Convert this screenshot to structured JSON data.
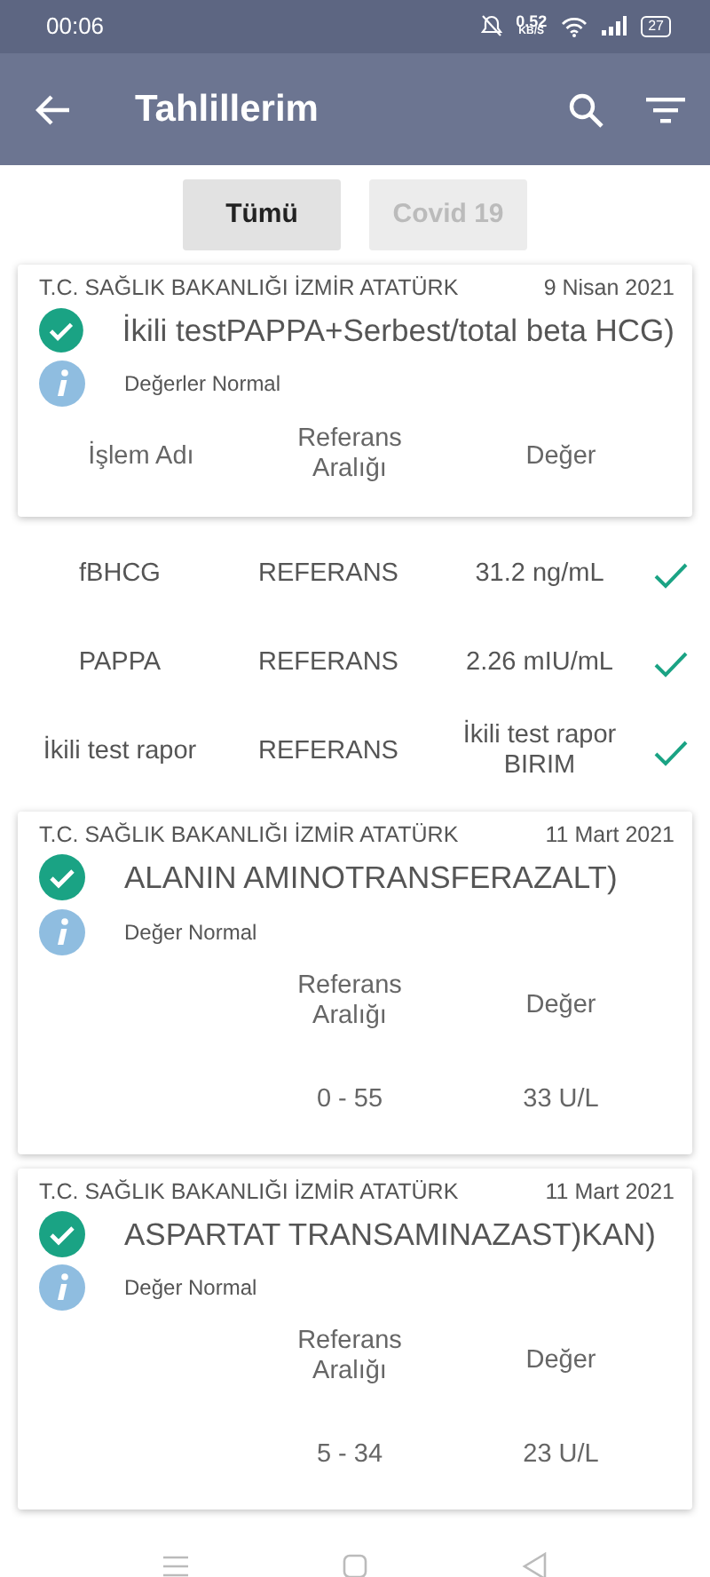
{
  "status_bar": {
    "time": "00:06",
    "speed_value": "0.52",
    "speed_unit": "KB/S",
    "battery": "27"
  },
  "app_bar": {
    "title": "Tahlillerim"
  },
  "tabs": [
    {
      "label": "Tümü",
      "selected": true
    },
    {
      "label": "Covid 19",
      "selected": false
    }
  ],
  "results": [
    {
      "kind": "card",
      "institution": "T.C. SAĞLIK BAKANLIĞI İZMİR ATATÜRK",
      "date": "9 Nisan 2021",
      "title": "İkili testPAPPA+Serbest/total beta HCG)",
      "status": "Değerler Normal",
      "columns": [
        {
          "kind": "name",
          "label": "İşlem Adı"
        },
        {
          "kind": "reference",
          "label": "Referans Aralığı"
        },
        {
          "kind": "value",
          "label": "Değer"
        }
      ]
    },
    {
      "kind": "row",
      "name": "fBHCG",
      "reference": "REFERANS",
      "value": "31.2 ng/mL",
      "checked": true
    },
    {
      "kind": "row",
      "name": "PAPPA",
      "reference": "REFERANS",
      "value": "2.26 mIU/mL",
      "checked": true
    },
    {
      "kind": "row",
      "name": "İkili test rapor",
      "reference": "REFERANS",
      "value": "İkili test rapor BIRIM",
      "checked": true
    },
    {
      "kind": "card",
      "institution": "T.C. SAĞLIK BAKANLIĞI İZMİR ATATÜRK",
      "date": "11 Mart 2021",
      "title": "ALANIN AMINOTRANSFERAZALT)",
      "status": "Değer Normal",
      "columns": [
        {
          "kind": "reference",
          "label": "Referans Aralığı"
        },
        {
          "kind": "value",
          "label": "Değer"
        }
      ],
      "rows": [
        {
          "reference": "0 - 55",
          "value": "33 U/L"
        }
      ]
    },
    {
      "kind": "card",
      "institution": "T.C. SAĞLIK BAKANLIĞI İZMİR ATATÜRK",
      "date": "11 Mart 2021",
      "title": "ASPARTAT TRANSAMINAZAST)KAN)",
      "status": "Değer Normal",
      "columns": [
        {
          "kind": "reference",
          "label": "Referans Aralığı"
        },
        {
          "kind": "value",
          "label": "Değer"
        }
      ],
      "rows": [
        {
          "reference": "5 - 34",
          "value": "23 U/L"
        }
      ]
    }
  ]
}
